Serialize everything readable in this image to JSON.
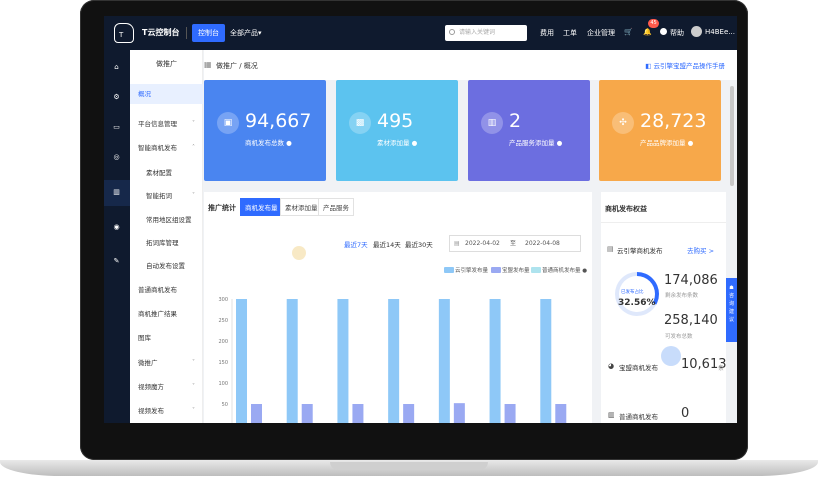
{
  "topbar": {
    "logo_text": "T",
    "brand": "T云控制台",
    "console_label": "控制台",
    "products_label": "全部产品▾",
    "search_placeholder": "请输入关键词",
    "nav": [
      "费用",
      "工单",
      "企业管理"
    ],
    "notification_count": "45",
    "help_label": "帮助",
    "username": "H4BEe..."
  },
  "menu": {
    "title": "做推广",
    "items": [
      {
        "label": "概况",
        "active": true
      },
      {
        "label": "平台信息管理",
        "chev": "˅"
      },
      {
        "label": "智能商机发布",
        "chev": "˄"
      },
      {
        "label": "素材配置",
        "sub": true
      },
      {
        "label": "智能拓词",
        "sub": true,
        "chev": "˅"
      },
      {
        "label": "常用地区组设置",
        "sub": true
      },
      {
        "label": "拓词库管理",
        "sub": true
      },
      {
        "label": "自动发布设置",
        "sub": true
      },
      {
        "label": "普通商机发布"
      },
      {
        "label": "商机推广结果"
      },
      {
        "label": "图库"
      },
      {
        "label": "微推广",
        "chev": "˅"
      },
      {
        "label": "视频魔方",
        "chev": "˅"
      },
      {
        "label": "视频发布",
        "chev": "˅"
      }
    ]
  },
  "breadcrumb": {
    "grid_icon": "grid-icon",
    "path": "做推广 / 概况",
    "help_link": "云引擎宝盟产品操作手册"
  },
  "cards": [
    {
      "value": "94,667",
      "label": "商机发布总数 ●",
      "color": "#4a85f0",
      "icon": "▣"
    },
    {
      "value": "495",
      "label": "素材添加量 ●",
      "color": "#5cc3ef",
      "icon": "▩"
    },
    {
      "value": "2",
      "label": "产品服务添加量 ●",
      "color": "#6c6ee0",
      "icon": "▥"
    },
    {
      "value": "28,723",
      "label": "产品品牌添加量 ●",
      "color": "#f7a84a",
      "icon": "✣"
    }
  ],
  "chart_panel": {
    "title": "推广统计",
    "tabs": [
      "商机发布量",
      "素材添加量",
      "产品服务"
    ],
    "active_tab": 0,
    "ranges": [
      "最近7天",
      "最近14天",
      "最近30天"
    ],
    "active_range": 0,
    "date_from": "2022-04-02",
    "date_to_label": "至",
    "date_to": "2022-04-08"
  },
  "chart_data": {
    "type": "bar",
    "categories": [
      "",
      "",
      "",
      "",
      "",
      "",
      ""
    ],
    "series": [
      {
        "name": "云引擎发布量",
        "color": "#8ec8f7",
        "values": [
          300,
          300,
          300,
          300,
          300,
          300,
          300
        ]
      },
      {
        "name": "宝盟发布量",
        "color": "#9aa9f2",
        "values": [
          50,
          50,
          50,
          50,
          52,
          50,
          50
        ]
      },
      {
        "name": "普通商机发布量",
        "color": "#aee3ee",
        "values": [
          0,
          0,
          0,
          0,
          0,
          0,
          0
        ]
      }
    ],
    "legend_suffix": "●",
    "yticks": [
      "0",
      "50",
      "100",
      "150",
      "200",
      "250",
      "300"
    ],
    "ylim": [
      0,
      300
    ],
    "legend_position": "top-right"
  },
  "right_panel": {
    "title": "商机发布权益",
    "section1_title": "云引擎商机发布",
    "section1_link": "去购买 >",
    "ring_label": "已发布占比",
    "ring_value": "32.56%",
    "remaining_value": "174,086",
    "remaining_label": "剩余发布条数",
    "available_value": "258,140",
    "available_label": "可发布总数",
    "section2_title": "宝盟商机发布",
    "section2_value": "10,613",
    "section2_unit": "条",
    "section3_title": "普通商机发布",
    "section3_value": "0"
  },
  "float_button": {
    "label": "咨询建议"
  }
}
